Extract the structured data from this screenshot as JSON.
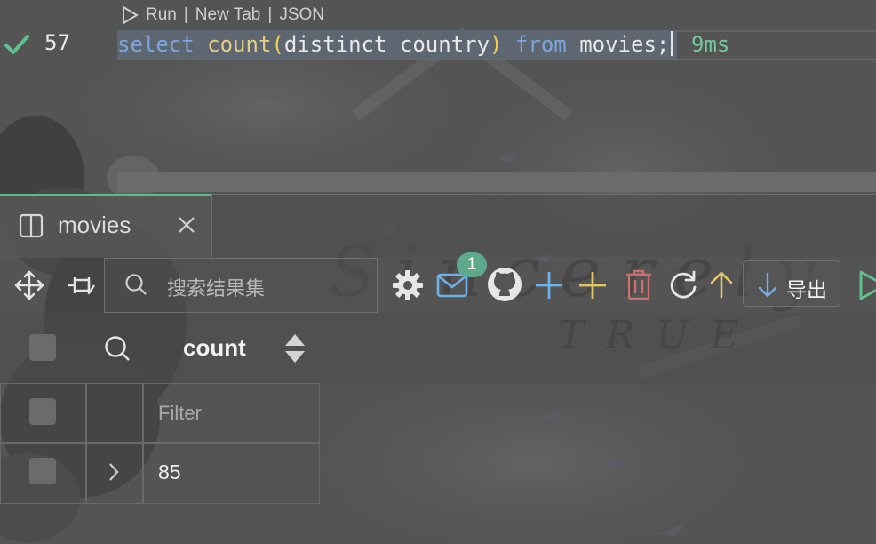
{
  "editor": {
    "codelens": {
      "run": "Run",
      "sep1": "|",
      "new_tab": "New Tab",
      "sep2": "|",
      "json": "JSON"
    },
    "line_number": "57",
    "query_tokens": {
      "t1": "select",
      "t2": "count",
      "t3": "(",
      "t4": "distinct country",
      "t5": ")",
      "t6": "from",
      "t7": "movies;"
    },
    "duration": "9ms",
    "status_icon": "check-icon",
    "status_color": "#5fc08c"
  },
  "result_tab": {
    "label": "movies",
    "icon": "split-panel-icon",
    "close_icon": "close-icon"
  },
  "toolbar": {
    "search_placeholder": "搜索结果集",
    "notification_count": "1",
    "export_label": "导出",
    "icons": [
      "move-icon",
      "pin-icon",
      "search-icon",
      "gear-icon",
      "mail-icon",
      "github-icon",
      "add-row-icon",
      "add-column-icon",
      "delete-icon",
      "refresh-icon",
      "upload-icon",
      "download-icon",
      "run-icon"
    ],
    "accent_colors": {
      "mail": "#6fb0e8",
      "add_row": "#6fb0e8",
      "add_column": "#e2c464",
      "delete": "#c9706c",
      "upload": "#e2c464",
      "run": "#5fc08c"
    }
  },
  "grid": {
    "column": "count",
    "filter_placeholder": "Filter",
    "rows": [
      {
        "count": "85"
      }
    ]
  },
  "wallpaper": {
    "text_1": "Sincerely",
    "text_2": "TRUE"
  }
}
